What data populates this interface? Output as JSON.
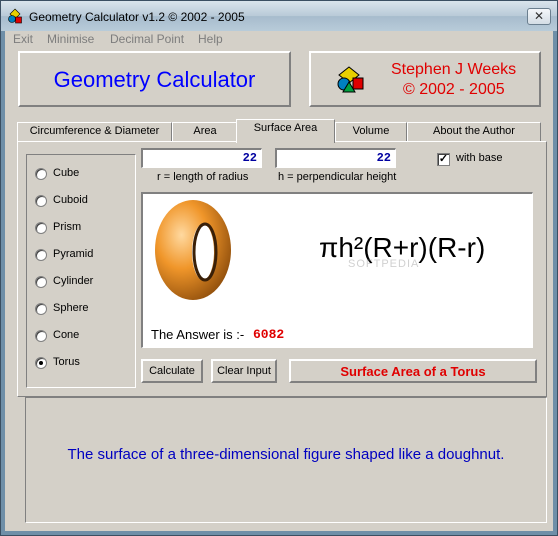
{
  "window": {
    "title": "Geometry Calculator v1.2 ©  2002 - 2005",
    "close_symbol": "✕",
    "app_icon": "geometry-shapes-icon"
  },
  "menu": [
    "Exit",
    "Minimise",
    "Decimal Point",
    "Help"
  ],
  "header": {
    "app_name": "Geometry Calculator",
    "author": "Stephen J Weeks",
    "years": "© 2002 - 2005"
  },
  "tabs": [
    {
      "label": "Circumference & Diameter",
      "active": false
    },
    {
      "label": "Area",
      "active": false
    },
    {
      "label": "Surface Area",
      "active": true
    },
    {
      "label": "Volume",
      "active": false
    },
    {
      "label": "About the Author",
      "active": false
    }
  ],
  "shapes": [
    {
      "label": "Cube",
      "selected": false
    },
    {
      "label": "Cuboid",
      "selected": false
    },
    {
      "label": "Prism",
      "selected": false
    },
    {
      "label": "Pyramid",
      "selected": false
    },
    {
      "label": "Cylinder",
      "selected": false
    },
    {
      "label": "Sphere",
      "selected": false
    },
    {
      "label": "Cone",
      "selected": false
    },
    {
      "label": "Torus",
      "selected": true
    }
  ],
  "inputs": {
    "radius": {
      "value": "22",
      "caption": "r = length of radius"
    },
    "height": {
      "value": "22",
      "caption": "h = perpendicular height"
    },
    "with_base": {
      "label": "with base",
      "checked": true,
      "mark": "✓"
    }
  },
  "display": {
    "formula": "πh²(R+r)(R-r)",
    "answer_label": "The Answer is :-",
    "answer_value": "6082",
    "shape_image": "torus-icon"
  },
  "buttons": {
    "calculate": "Calculate",
    "clear": "Clear Input"
  },
  "result_title": "Surface Area of a Torus",
  "description": "The surface of a three-dimensional figure shaped like a doughnut.",
  "watermark": "SOFTPEDIA",
  "colors": {
    "title_blue": "#0000ff",
    "accent_red": "#e00000",
    "torus_orange": "#f0962a",
    "face": "#d4d0c8"
  }
}
